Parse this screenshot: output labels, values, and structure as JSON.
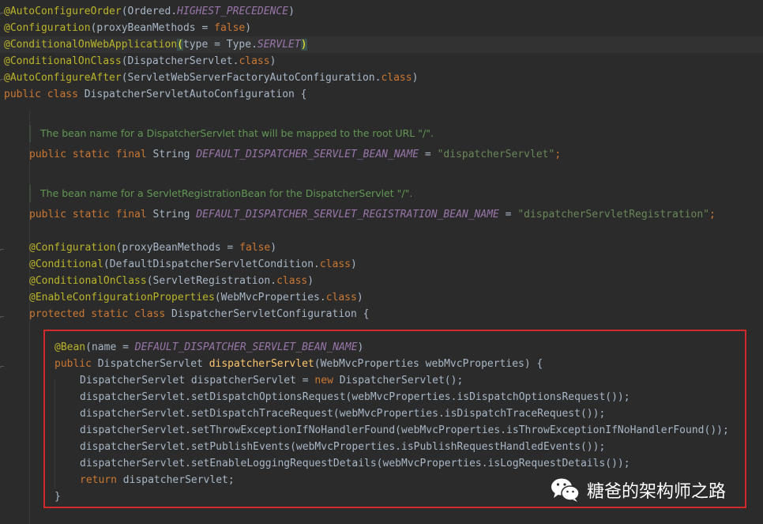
{
  "colors": {
    "background": "#2b2b2b",
    "keyword": "#cc7832",
    "annotation": "#bbb529",
    "string": "#6a8759",
    "constant": "#9876aa",
    "method": "#ffc66d",
    "text": "#a9b7c6",
    "javadoc": "#629755",
    "highlight_box": "#d2292b"
  },
  "code": {
    "l1": {
      "ann": "@AutoConfigureOrder",
      "a": "(Ordered.",
      "c": "HIGHEST_PRECEDENCE",
      "b": ")"
    },
    "l2": {
      "ann": "@Configuration",
      "a": "(proxyBeanMethods = ",
      "kw": "false",
      "b": ")"
    },
    "l3": {
      "ann": "@ConditionalOnWebApplication",
      "p1": "(",
      "a": "type = Type.",
      "c": "SERVLET",
      "p2": ")"
    },
    "l4": {
      "ann": "@ConditionalOnClass",
      "a": "(DispatcherServlet.",
      "kw": "class",
      "b": ")"
    },
    "l5": {
      "ann": "@AutoConfigureAfter",
      "a": "(ServletWebServerFactoryAutoConfiguration.",
      "kw": "class",
      "b": ")"
    },
    "l6": {
      "kw": "public class ",
      "a": "DispatcherServletAutoConfiguration {"
    },
    "doc1": "The bean name for a DispatcherServlet that will be mapped to the root URL \"/\".",
    "l7": {
      "kw": "public static final ",
      "a": "String ",
      "c": "DEFAULT_DISPATCHER_SERVLET_BEAN_NAME",
      "b": " = ",
      "s": "\"dispatcherServlet\"",
      "e": ";"
    },
    "doc2": "The bean name for a ServletRegistrationBean for the DispatcherServlet \"/\".",
    "l8": {
      "kw": "public static final ",
      "a": "String ",
      "c": "DEFAULT_DISPATCHER_SERVLET_REGISTRATION_BEAN_NAME",
      "b": " = ",
      "s": "\"dispatcherServletRegistration\"",
      "e": ";"
    },
    "l9": {
      "ann": "@Configuration",
      "a": "(proxyBeanMethods = ",
      "kw": "false",
      "b": ")"
    },
    "l10": {
      "ann": "@Conditional",
      "a": "(DefaultDispatcherServletCondition.",
      "kw": "class",
      "b": ")"
    },
    "l11": {
      "ann": "@ConditionalOnClass",
      "a": "(ServletRegistration.",
      "kw": "class",
      "b": ")"
    },
    "l12": {
      "ann": "@EnableConfigurationProperties",
      "a": "(WebMvcProperties.",
      "kw": "class",
      "b": ")"
    },
    "l13": {
      "kw": "protected static class ",
      "a": "DispatcherServletConfiguration {"
    },
    "l14": {
      "ann": "@Bean",
      "a": "(name = ",
      "c": "DEFAULT_DISPATCHER_SERVLET_BEAN_NAME",
      "b": ")"
    },
    "l15": {
      "kw": "public ",
      "a": "DispatcherServlet ",
      "fn": "dispatcherServlet",
      "b": "(WebMvcProperties webMvcProperties) {"
    },
    "l16": {
      "a": "DispatcherServlet dispatcherServlet = ",
      "kw": "new ",
      "b": "DispatcherServlet();"
    },
    "l17": "dispatcherServlet.setDispatchOptionsRequest(webMvcProperties.isDispatchOptionsRequest());",
    "l18": "dispatcherServlet.setDispatchTraceRequest(webMvcProperties.isDispatchTraceRequest());",
    "l19": "dispatcherServlet.setThrowExceptionIfNoHandlerFound(webMvcProperties.isThrowExceptionIfNoHandlerFound());",
    "l20": "dispatcherServlet.setPublishEvents(webMvcProperties.isPublishRequestHandledEvents());",
    "l21": "dispatcherServlet.setEnableLoggingRequestDetails(webMvcProperties.isLogRequestDetails());",
    "l22": {
      "kw": "return ",
      "a": "dispatcherServlet;"
    },
    "l23": "}"
  },
  "watermark": {
    "icon": "wechat-icon",
    "text": "糖爸的架构师之路"
  }
}
